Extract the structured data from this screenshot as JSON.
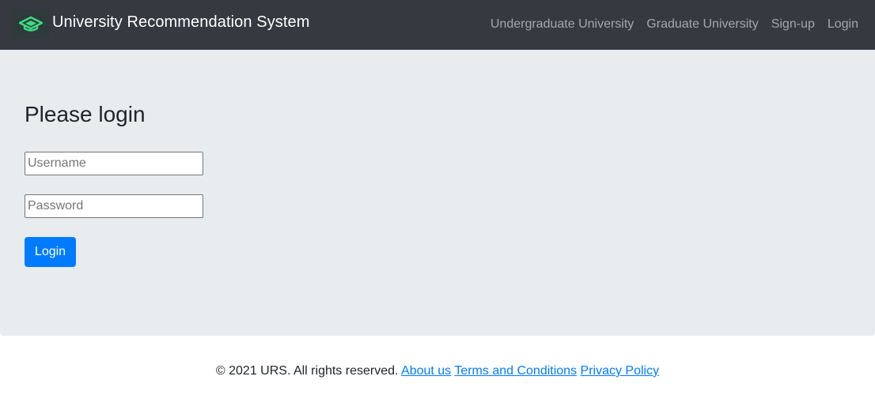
{
  "colors": {
    "navbar_bg": "#343a40",
    "jumbotron_bg": "#e9ecef",
    "primary": "#007bff",
    "logo_accent": "#3ddc84"
  },
  "navbar": {
    "logo_icon": "graduation-cap-icon",
    "brand": "University Recommendation System",
    "links": [
      {
        "label": "Undergraduate University"
      },
      {
        "label": "Graduate University"
      },
      {
        "label": "Sign-up"
      },
      {
        "label": "Login"
      }
    ]
  },
  "main": {
    "heading": "Please login",
    "username": {
      "placeholder": "Username",
      "value": ""
    },
    "password": {
      "placeholder": "Password",
      "value": ""
    },
    "login_label": "Login"
  },
  "footer": {
    "copyright": "© 2021 URS. All rights reserved.",
    "links": [
      {
        "label": "About us"
      },
      {
        "label": "Terms and Conditions"
      },
      {
        "label": "Privacy Policy"
      }
    ]
  }
}
